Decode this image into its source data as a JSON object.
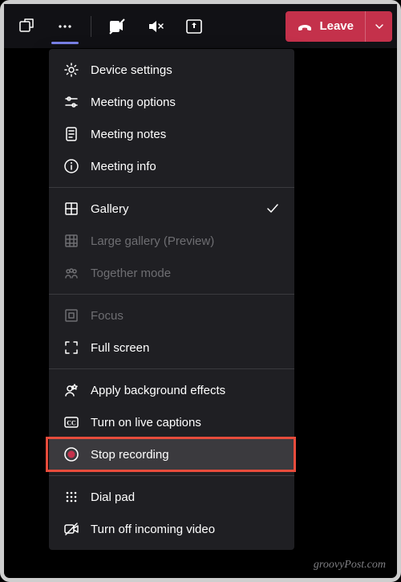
{
  "toolbar": {
    "leave_label": "Leave"
  },
  "menu": {
    "items": [
      {
        "label": "Device settings",
        "icon": "gear-icon",
        "enabled": true,
        "checked": false
      },
      {
        "label": "Meeting options",
        "icon": "sliders-icon",
        "enabled": true,
        "checked": false
      },
      {
        "label": "Meeting notes",
        "icon": "notes-icon",
        "enabled": true,
        "checked": false
      },
      {
        "label": "Meeting info",
        "icon": "info-icon",
        "enabled": true,
        "checked": false
      }
    ],
    "group2": [
      {
        "label": "Gallery",
        "icon": "grid-icon",
        "enabled": true,
        "checked": true
      },
      {
        "label": "Large gallery (Preview)",
        "icon": "large-grid-icon",
        "enabled": false,
        "checked": false
      },
      {
        "label": "Together mode",
        "icon": "people-icon",
        "enabled": false,
        "checked": false
      }
    ],
    "group3": [
      {
        "label": "Focus",
        "icon": "focus-icon",
        "enabled": false,
        "checked": false
      },
      {
        "label": "Full screen",
        "icon": "fullscreen-icon",
        "enabled": true,
        "checked": false
      }
    ],
    "group4": [
      {
        "label": "Apply background effects",
        "icon": "effects-icon",
        "enabled": true,
        "checked": false
      },
      {
        "label": "Turn on live captions",
        "icon": "cc-icon",
        "enabled": true,
        "checked": false
      },
      {
        "label": "Stop recording",
        "icon": "record-icon",
        "enabled": true,
        "checked": false,
        "highlight": true,
        "boxed": true
      }
    ],
    "group5": [
      {
        "label": "Dial pad",
        "icon": "dialpad-icon",
        "enabled": true,
        "checked": false
      },
      {
        "label": "Turn off incoming video",
        "icon": "video-off-icon",
        "enabled": true,
        "checked": false
      }
    ]
  },
  "watermark": "groovyPost.com"
}
